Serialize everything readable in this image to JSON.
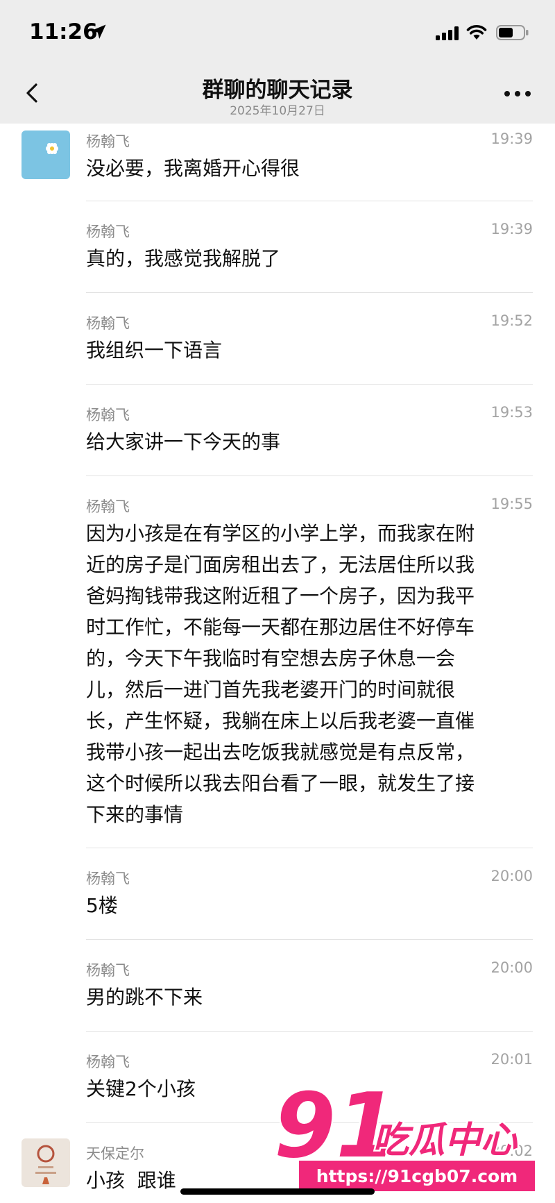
{
  "status": {
    "time": "11:26"
  },
  "header": {
    "title": "群聊的聊天记录",
    "date": "2025年10月27日"
  },
  "messages": [
    {
      "sender": "杨翰飞",
      "time": "19:39",
      "text": "没必要，我离婚开心得很"
    },
    {
      "sender": "杨翰飞",
      "time": "19:39",
      "text": "真的，我感觉我解脱了"
    },
    {
      "sender": "杨翰飞",
      "time": "19:52",
      "text": "我组织一下语言"
    },
    {
      "sender": "杨翰飞",
      "time": "19:53",
      "text": "给大家讲一下今天的事"
    },
    {
      "sender": "杨翰飞",
      "time": "19:55",
      "lines": [
        "因为小孩是在有学区的小学上学，而我家在附",
        "近的房子是门面房租出去了，无法居住所以我",
        "爸妈掏钱带我这附近租了一个房子，因为我平",
        "时工作忙，不能每一天都在那边居住不好停车",
        "的，今天下午我临时有空想去房子休息一会",
        "儿，然后一进门首先我老婆开门的时间就很",
        "长，产生怀疑，我躺在床上以后我老婆一直催",
        "我带小孩一起出去吃饭我就感觉是有点反常，",
        "这个时候所以我去阳台看了一眼，就发生了接",
        "下来的事情"
      ]
    },
    {
      "sender": "杨翰飞",
      "time": "20:00",
      "text": "5楼"
    },
    {
      "sender": "杨翰飞",
      "time": "20:00",
      "text": "男的跳不下来"
    },
    {
      "sender": "杨翰飞",
      "time": "20:01",
      "text": "关键2个小孩"
    },
    {
      "sender": "天保定尔",
      "time": "20:02",
      "text": "小孩  跟谁"
    }
  ],
  "watermark": {
    "brand_num": "91",
    "brand_cn": "吃瓜中心",
    "url": "https://91cgb07.com"
  },
  "colors": {
    "header_bg": "#ededed",
    "watermark_pink": "#f0287a",
    "separator": "#e2e2e2"
  }
}
